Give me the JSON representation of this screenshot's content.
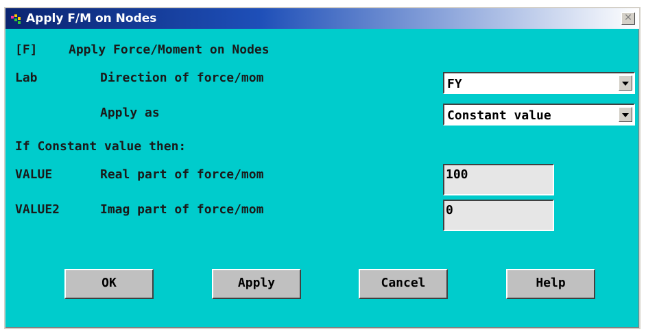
{
  "window": {
    "title": "Apply F/M on Nodes",
    "close_glyph": "✕"
  },
  "form": {
    "header_code": "[F]",
    "header_text": "Apply Force/Moment on Nodes",
    "lab_code": "Lab",
    "lab_text": "Direction of force/mom",
    "lab_value": "FY",
    "apply_as_text": "Apply as",
    "apply_as_value": "Constant value",
    "constant_header": "If Constant value then:",
    "value_code": "VALUE",
    "value_text": "Real part of force/mom",
    "value_input": "100",
    "value2_code": "VALUE2",
    "value2_text": "Imag part of force/mom",
    "value2_input": "0"
  },
  "buttons": {
    "ok": "OK",
    "apply": "Apply",
    "cancel": "Cancel",
    "help": "Help"
  },
  "icons": {
    "app": "ansys-app-icon",
    "close": "close-icon",
    "dropdown": "chevron-down-icon"
  },
  "colors": {
    "dialog_background": "#00cccc",
    "title_gradient_start": "#0a2470"
  }
}
